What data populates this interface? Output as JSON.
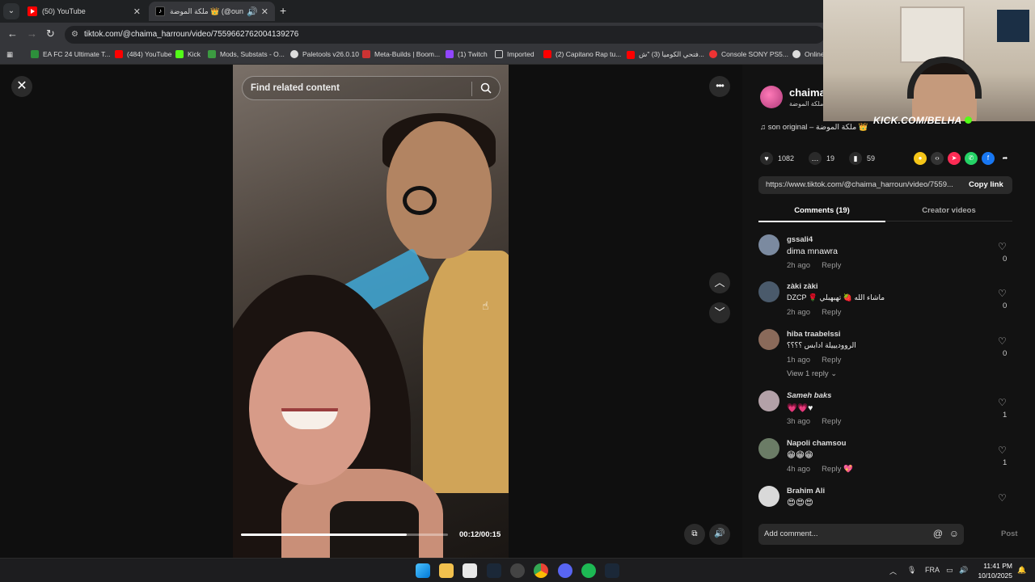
{
  "browser": {
    "tabs": [
      {
        "title": "(50) YouTube",
        "active": false
      },
      {
        "title": "ملكة الموضة 👑 (@oun",
        "active": true
      }
    ],
    "url": "tiktok.com/@chaima_harroun/video/7559662762004139276",
    "bookmarks": [
      "EA FC 24 Ultimate T...",
      "(484) YouTube",
      "Kick",
      "Mods, Substats - O...",
      "Paletools v26.0.10",
      "Meta-Builds | Boom...",
      "(1) Twitch",
      "Imported",
      "(2) Capitano Rap tu...",
      "فتحي الكوميا (3) \"ش...",
      "Console SONY PS5...",
      "Online"
    ]
  },
  "player": {
    "search_placeholder": "Find related content",
    "time": "00:12/00:15",
    "progress_fraction": 0.8
  },
  "panel": {
    "author_name": "chaima",
    "author_nick": "ملكة الموضة",
    "music": "son original – ملكة الموضة 👑",
    "likes": "1082",
    "comments_count": "19",
    "saves": "59",
    "link": "https://www.tiktok.com/@chaima_harroun/video/7559...",
    "copy_link": "Copy link",
    "tab_comments": "Comments (19)",
    "tab_creator": "Creator videos",
    "view_replies": "View 1 reply",
    "composer_placeholder": "Add comment...",
    "post": "Post",
    "comments": [
      {
        "name": "gssali4",
        "text": "dima mnawra",
        "time": "2h ago",
        "reply": "Reply",
        "likes": "0",
        "avatar_color": "#7b8aa0"
      },
      {
        "name": "zàki zàki",
        "text": "DZCP 🌹 ماشاء الله 🍓 تهبهبلي",
        "time": "2h ago",
        "reply": "Reply",
        "likes": "0",
        "avatar_color": "#4a5a6b"
      },
      {
        "name": "hiba traabelssi",
        "text": "الرووديييلة ادابس ؟؟؟؟",
        "time": "1h ago",
        "reply": "Reply",
        "likes": "0",
        "avatar_color": "#8a6a5a"
      },
      {
        "name": "Sameh baks",
        "text": "💗💗♥",
        "time": "3h ago",
        "reply": "Reply",
        "likes": "1",
        "avatar_color": "#b3a1a8"
      },
      {
        "name": "Napoli chamsou",
        "text": "😁😁😁",
        "time": "4h ago",
        "reply": "Reply",
        "likes": "1",
        "avatar_color": "#6b7c66"
      },
      {
        "name": "Brahim Ali",
        "text": "😍😍😍",
        "time": "",
        "reply": "",
        "likes": "",
        "avatar_color": "#d9d9d9"
      }
    ]
  },
  "overlay": {
    "kick_text": "KICK.COM/BELHA"
  },
  "taskbar": {
    "lang": "FRA",
    "time": "11:41 PM",
    "date": "10/10/2025"
  }
}
